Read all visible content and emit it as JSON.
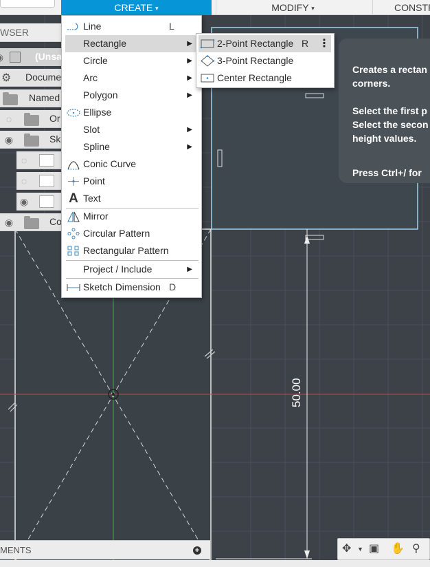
{
  "toolbar": {
    "create_label": "CREATE",
    "modify_label": "MODIFY",
    "construct_label": "CONSTR",
    "caret": "▾"
  },
  "browser": {
    "header": "WSER",
    "rows": [
      {
        "label": "(Unsa"
      },
      {
        "label": "Docume"
      },
      {
        "label": "Named"
      },
      {
        "label": "Or"
      },
      {
        "label": "Sk"
      },
      {
        "label": "Co"
      }
    ]
  },
  "comments": {
    "label": "MENTS",
    "add_icon": "+"
  },
  "create_menu": {
    "items": [
      {
        "label": "Line",
        "shortcut": "L",
        "icon": "line-icon"
      },
      {
        "label": "Rectangle",
        "icon": "rectangle-icon",
        "submenu": true,
        "highlighted": true
      },
      {
        "label": "Circle",
        "submenu": true
      },
      {
        "label": "Arc",
        "submenu": true
      },
      {
        "label": "Polygon",
        "submenu": true
      },
      {
        "label": "Ellipse",
        "icon": "ellipse-icon"
      },
      {
        "label": "Slot",
        "submenu": true
      },
      {
        "label": "Spline",
        "submenu": true
      },
      {
        "label": "Conic Curve",
        "icon": "conic-curve-icon"
      },
      {
        "label": "Point",
        "icon": "point-icon"
      },
      {
        "label": "Text",
        "icon": "text-icon"
      },
      {
        "label": "Mirror",
        "icon": "mirror-icon"
      },
      {
        "label": "Circular Pattern",
        "icon": "circular-pattern-icon"
      },
      {
        "label": "Rectangular Pattern",
        "icon": "rectangular-pattern-icon"
      },
      {
        "label": "Project / Include",
        "submenu": true
      },
      {
        "label": "Sketch Dimension",
        "shortcut": "D",
        "icon": "sketch-dimension-icon"
      }
    ],
    "submenu_arrow": "▶"
  },
  "rectangle_submenu": {
    "items": [
      {
        "label": "2-Point Rectangle",
        "shortcut": "R",
        "highlighted": true
      },
      {
        "label": "3-Point Rectangle"
      },
      {
        "label": "Center Rectangle"
      }
    ],
    "more_icon": "⋮"
  },
  "tooltip": {
    "lines": [
      "Creates a rectan",
      "corners.",
      "Select the first p",
      "Select the secon",
      "height values.",
      "Press Ctrl+/ for"
    ]
  },
  "dimension": {
    "value": "50.00"
  },
  "colors": {
    "accent": "#0696d7",
    "canvas": "#3c4248",
    "menu_highlight": "#d9d9d9",
    "tooltip": "#4b5359"
  }
}
